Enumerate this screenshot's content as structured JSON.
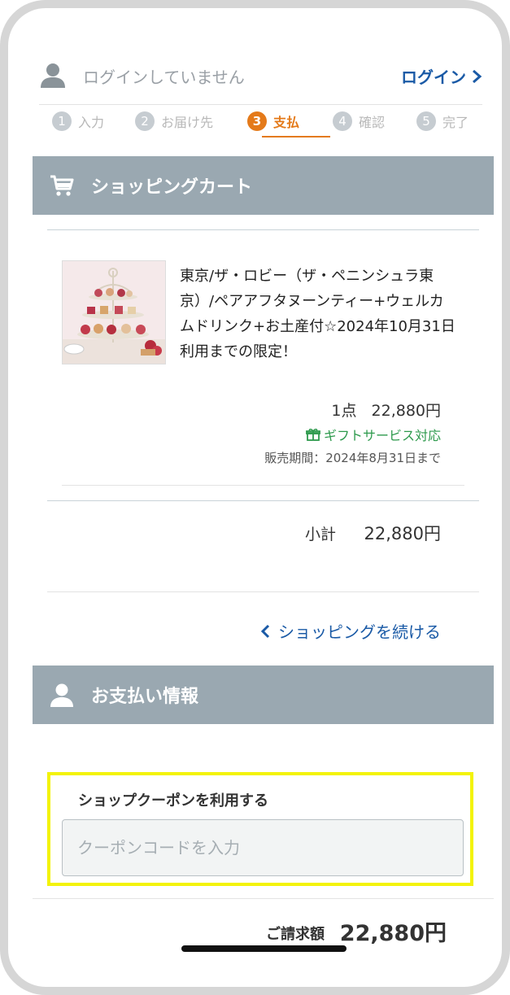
{
  "header": {
    "login_status": "ログインしていません",
    "login_link": "ログイン"
  },
  "steps": [
    {
      "num": "1",
      "label": "入力"
    },
    {
      "num": "2",
      "label": "お届け先"
    },
    {
      "num": "3",
      "label": "支払"
    },
    {
      "num": "4",
      "label": "確認"
    },
    {
      "num": "5",
      "label": "完了"
    }
  ],
  "active_step": 3,
  "cart": {
    "section_title": "ショッピングカート",
    "item": {
      "title": "東京/ザ・ロビー（ザ・ペニンシュラ東京）/ペアアフタヌーンティー+ウェルカムドリンク+お土産付☆2024年10月31日利用までの限定！",
      "qty": "1点",
      "price": "22,880円",
      "gift": "ギフトサービス対応",
      "period": "販売期間：2024年8月31日まで"
    },
    "subtotal_label": "小計",
    "subtotal_value": "22,880円",
    "continue_link": "ショッピングを続ける"
  },
  "payment": {
    "section_title": "お支払い情報",
    "coupon_label": "ショップクーポンを利用する",
    "coupon_placeholder": "クーポンコードを入力",
    "coupon_value": ""
  },
  "footer": {
    "total_label": "ご請求額",
    "total_value": "22,880円"
  },
  "colors": {
    "accent": "#e47a1a",
    "link": "#1a5aa6",
    "section_bar": "#9aa8b1",
    "gift": "#2e9a4d",
    "highlight": "#f3f30a"
  }
}
